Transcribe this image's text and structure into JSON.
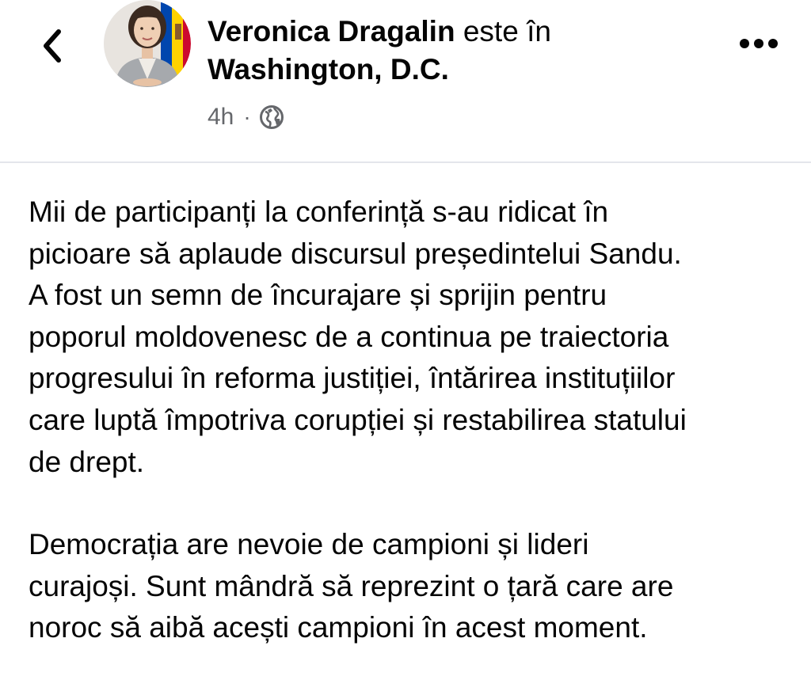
{
  "header": {
    "author_name": "Veronica Dragalin",
    "connector": " este în",
    "location": "Washington, D.C.",
    "timestamp": "4h",
    "separator": "·",
    "audience_icon": "globe-icon",
    "back_icon": "chevron-left-icon",
    "more_icon": "more-horizontal-icon"
  },
  "post": {
    "paragraphs": [
      "Mii de participanți la conferință s-au ridicat în\npicioare să aplaude discursul președintelui Sandu.\nA fost un semn de încurajare și sprijin pentru\npoporul moldovenesc de a continua pe traiectoria\nprogresului în reforma justiției, întărirea instituțiilor\ncare luptă împotriva corupției și restabilirea statului\nde drept.",
      "Democrația are nevoie de campioni și lideri\ncurajoși. Sunt mândră să reprezint o țară care are\nnoroc să aibă acești campioni în acest moment."
    ]
  },
  "colors": {
    "text_primary": "#050505",
    "text_secondary": "#65676b",
    "divider": "#e4e6eb",
    "background": "#ffffff"
  }
}
